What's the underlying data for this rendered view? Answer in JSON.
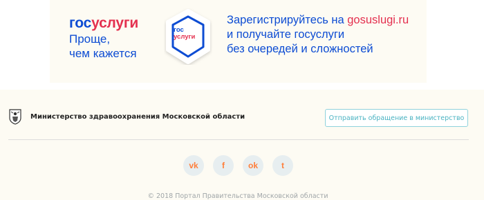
{
  "banner": {
    "logo_part1": "гос",
    "logo_part2": "услуги",
    "slogan_line1": "Проще,",
    "slogan_line2": "чем кажется",
    "badge_line1": "гос",
    "badge_line2": "услуги",
    "promo_line1_text": "Зарегистрируйтесь на ",
    "promo_line1_site": "gosuslugi.ru",
    "promo_line2": "и получайте госуслуги",
    "promo_line3": "без очередей  и сложностей",
    "colors": {
      "blue": "#0d4cd3",
      "red": "#e4304f"
    }
  },
  "footer": {
    "emblem_icon": "coat-of-arms-icon",
    "ministry_name": "Министерство здравоохранения Московской области",
    "appeal_button": "Отправить обращение в министерство",
    "socials": [
      {
        "icon": "vk-icon",
        "glyph": "vk"
      },
      {
        "icon": "facebook-icon",
        "glyph": "f"
      },
      {
        "icon": "odnoklassniki-icon",
        "glyph": "ok"
      },
      {
        "icon": "twitter-icon",
        "glyph": "t"
      }
    ],
    "copyright": "© 2018 Портал Правительства Московской области",
    "accent_color": "#ff7e3a"
  }
}
